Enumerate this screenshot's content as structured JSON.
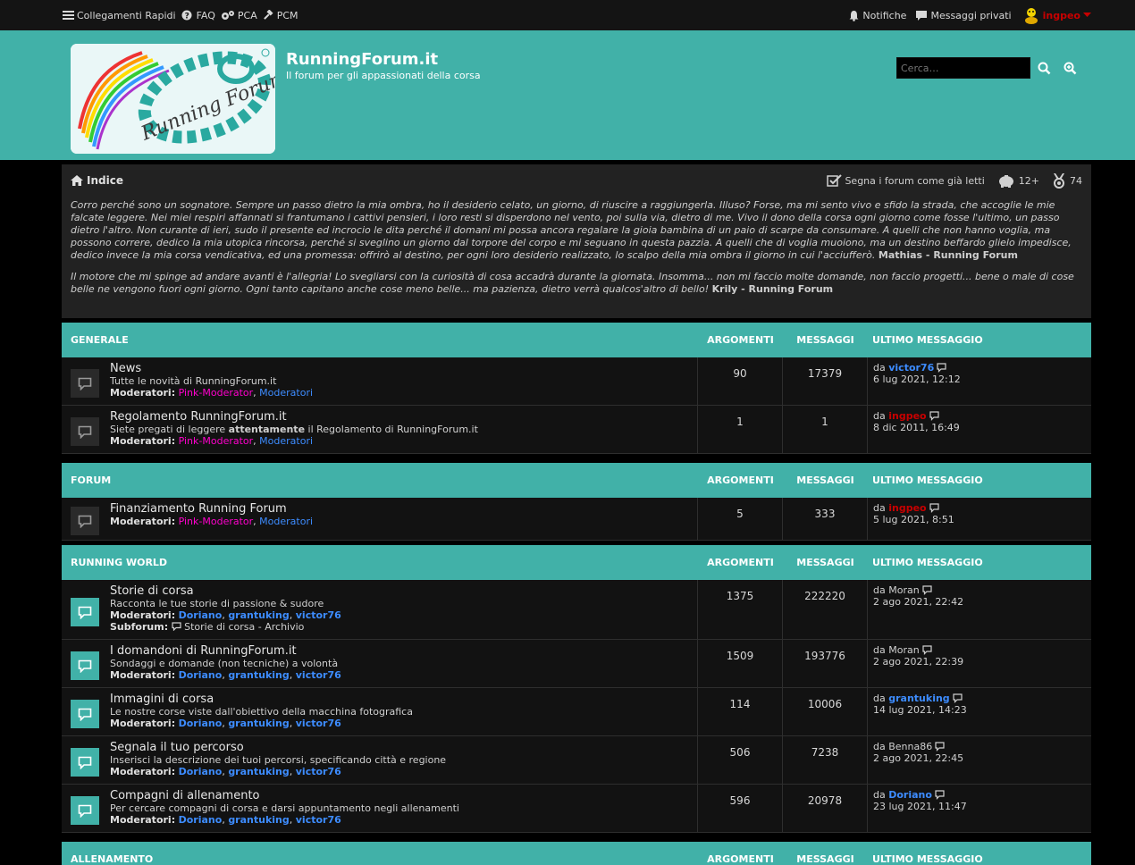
{
  "topbar": {
    "quick_links": "Collegamenti Rapidi",
    "faq": "FAQ",
    "ucp": "PCA",
    "mcp": "PCM",
    "notifications": "Notifiche",
    "private_messages": "Messaggi privati",
    "username": "ingpeo"
  },
  "header": {
    "title": "RunningForum.it",
    "description": "Il forum per gli appassionati della corsa",
    "logo_text": "Running Forum",
    "search_placeholder": "Cerca…"
  },
  "nav": {
    "breadcrumb": "Indice",
    "mark_read": "Segna i forum come già letti",
    "badge1": "12+",
    "badge2": "74"
  },
  "quotes": [
    {
      "text": "Corro perché sono un sognatore. Sempre un passo dietro la mia ombra, ho il desiderio celato, un giorno, di riuscire a raggiungerla. Illuso? Forse, ma mi sento vivo e sfido la strada, che accoglie le mie falcate leggere. Nei miei respiri affannati si frantumano i cattivi pensieri, i loro resti si disperdono nel vento, poi sulla via, dietro di me. Vivo il dono della corsa ogni giorno come fosse l'ultimo, un passo dietro l'altro. Non curante di ieri, sudo il presente ed incrocio le dita perché il domani mi possa ancora regalare la gioia bambina di un paio di scarpe da consumare. A quelli che non hanno voglia, ma possono correre, dedico la mia utopica rincorsa, perché si sveglino un giorno dal torpore del corpo e mi seguano in questa pazzia. A quelli che di voglia muoiono, ma un destino beffardo glielo impedisce, dedico invece la mia corsa vendicativa, ed una promessa: offrirò al destino, per ogni loro desiderio realizzato, lo scalpo della mia ombra il giorno in cui l'acciufferò.",
      "author": "Mathias - Running Forum"
    },
    {
      "text": "Il motore che mi spinge ad andare avanti è l'allegria! Lo svegliarsi con la curiosità di cosa accadrà durante la giornata. Insomma... non mi faccio molte domande, non faccio progetti... bene o male di cose belle ne vengono fuori ogni giorno. Ogni tanto capitano anche cose meno belle... ma pazienza, dietro verrà qualcos'altro di bello!",
      "author": "Krily - Running Forum"
    }
  ],
  "columns": {
    "topics": "ARGOMENTI",
    "posts": "MESSAGGI",
    "last_post": "ULTIMO MESSAGGIO"
  },
  "labels": {
    "moderators": "Moderatori:",
    "subforum": "Subforum:",
    "by": "da"
  },
  "categories": [
    {
      "name": "GENERALE",
      "forums": [
        {
          "title": "News",
          "desc": "Tutte le novità di RunningForum.it",
          "mods": [
            {
              "name": "Pink-Moderator",
              "style": "pink"
            },
            {
              "name": "Moderatori",
              "style": "blue"
            }
          ],
          "topics": "90",
          "posts": "17379",
          "last_by": "victor76",
          "last_by_style": "blueb",
          "last_date": "6 lug 2021, 12:12",
          "unread": false
        },
        {
          "title": "Regolamento RunningForum.it",
          "desc_pre": "Siete pregati di leggere ",
          "desc_bold": "attentamente",
          "desc_post": " il Regolamento di RunningForum.it",
          "mods": [
            {
              "name": "Pink-Moderator",
              "style": "pink"
            },
            {
              "name": "Moderatori",
              "style": "blue"
            }
          ],
          "topics": "1",
          "posts": "1",
          "last_by": "ingpeo",
          "last_by_style": "red",
          "last_date": "8 dic 2011, 16:49",
          "unread": false
        }
      ]
    },
    {
      "name": "FORUM",
      "forums": [
        {
          "title": "Finanziamento Running Forum",
          "mods": [
            {
              "name": "Pink-Moderator",
              "style": "pink"
            },
            {
              "name": "Moderatori",
              "style": "blue"
            }
          ],
          "topics": "5",
          "posts": "333",
          "last_by": "ingpeo",
          "last_by_style": "red",
          "last_date": "5 lug 2021, 8:51",
          "unread": false
        }
      ]
    },
    {
      "name": "RUNNING WORLD",
      "forums": [
        {
          "title": "Storie di corsa",
          "desc": "Racconta le tue storie di passione & sudore",
          "mods": [
            {
              "name": "Doriano",
              "style": "blueb"
            },
            {
              "name": "grantuking",
              "style": "blueb"
            },
            {
              "name": "victor76",
              "style": "blueb"
            }
          ],
          "subforum": "Storie di corsa - Archivio",
          "topics": "1375",
          "posts": "222220",
          "last_by": "Moran",
          "last_by_style": "plain",
          "last_date": "2 ago 2021, 22:42",
          "unread": true
        },
        {
          "title": "I domandoni di RunningForum.it",
          "desc": "Sondaggi e domande (non tecniche) a volontà",
          "mods": [
            {
              "name": "Doriano",
              "style": "blueb"
            },
            {
              "name": "grantuking",
              "style": "blueb"
            },
            {
              "name": "victor76",
              "style": "blueb"
            }
          ],
          "topics": "1509",
          "posts": "193776",
          "last_by": "Moran",
          "last_by_style": "plain",
          "last_date": "2 ago 2021, 22:39",
          "unread": true
        },
        {
          "title": "Immagini di corsa",
          "desc": "Le nostre corse viste dall'obiettivo della macchina fotografica",
          "mods": [
            {
              "name": "Doriano",
              "style": "blueb"
            },
            {
              "name": "grantuking",
              "style": "blueb"
            },
            {
              "name": "victor76",
              "style": "blueb"
            }
          ],
          "topics": "114",
          "posts": "10006",
          "last_by": "grantuking",
          "last_by_style": "blueb",
          "last_date": "14 lug 2021, 14:23",
          "unread": true
        },
        {
          "title": "Segnala il tuo percorso",
          "desc": "Inserisci la descrizione dei tuoi percorsi, specificando città e regione",
          "mods": [
            {
              "name": "Doriano",
              "style": "blueb"
            },
            {
              "name": "grantuking",
              "style": "blueb"
            },
            {
              "name": "victor76",
              "style": "blueb"
            }
          ],
          "topics": "506",
          "posts": "7238",
          "last_by": "Benna86",
          "last_by_style": "plain",
          "last_date": "2 ago 2021, 22:45",
          "unread": true
        },
        {
          "title": "Compagni di allenamento",
          "desc": "Per cercare compagni di corsa e darsi appuntamento negli allenamenti",
          "mods": [
            {
              "name": "Doriano",
              "style": "blueb"
            },
            {
              "name": "grantuking",
              "style": "blueb"
            },
            {
              "name": "victor76",
              "style": "blueb"
            }
          ],
          "topics": "596",
          "posts": "20978",
          "last_by": "Doriano",
          "last_by_style": "blueb",
          "last_date": "23 lug 2021, 11:47",
          "unread": true
        }
      ]
    },
    {
      "name": "ALLENAMENTO",
      "forums": []
    }
  ],
  "colors": {
    "accent": "#41b1a8",
    "moderator_pink": "#ff00cc",
    "moderator_blue": "#3d8cff",
    "admin_red": "#c80000"
  }
}
